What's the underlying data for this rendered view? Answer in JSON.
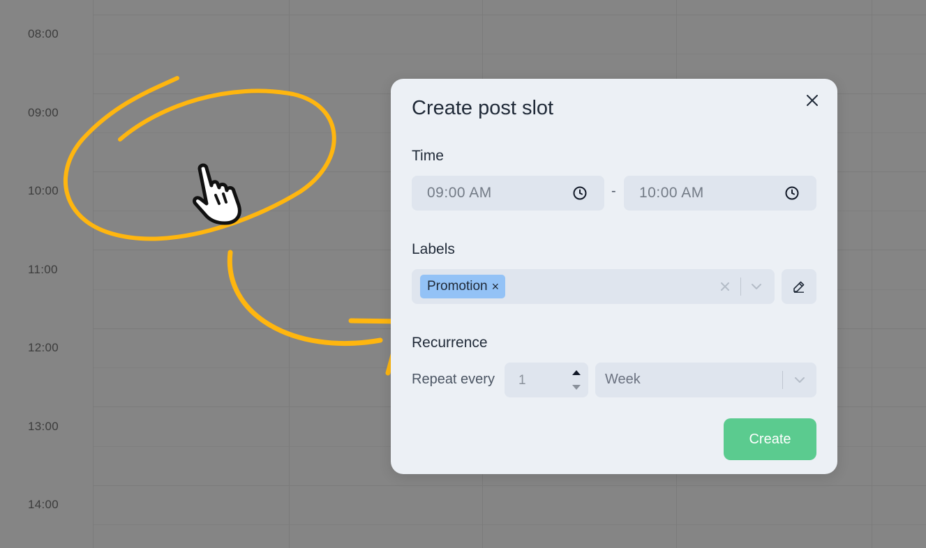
{
  "calendar": {
    "times": [
      "08:00",
      "09:00",
      "10:00",
      "11:00",
      "12:00",
      "13:00",
      "14:00"
    ]
  },
  "modal": {
    "title": "Create post slot",
    "close_icon": "close-icon",
    "time": {
      "label": "Time",
      "start": "09:00 AM",
      "separator": "-",
      "end": "10:00 AM",
      "icon": "clock-icon"
    },
    "labels": {
      "label": "Labels",
      "chips": [
        {
          "text": "Promotion",
          "remove": "×"
        }
      ],
      "edit_icon": "pencil-icon"
    },
    "recurrence": {
      "label": "Recurrence",
      "repeat_label": "Repeat every",
      "count": "1",
      "unit": "Week"
    },
    "create_label": "Create"
  },
  "colors": {
    "overlay_bg": "#858585",
    "modal_bg": "#ecf0f5",
    "field_bg": "#dfe5ee",
    "chip_bg": "#93c2f6",
    "create_btn": "#5bcb8f",
    "annotation": "#ffb60f"
  }
}
